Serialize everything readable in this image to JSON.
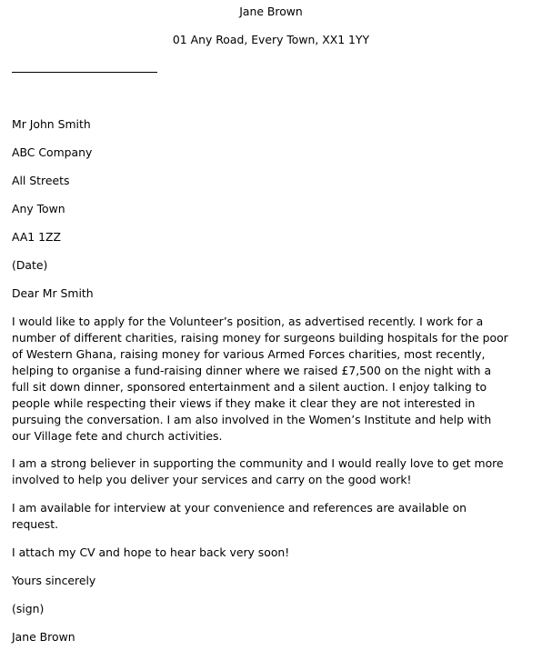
{
  "sender": {
    "name": "Jane Brown",
    "address": "01 Any Road, Every Town, XX1 1YY"
  },
  "recipient": {
    "name": "Mr John Smith",
    "company": "ABC Company",
    "street": "All Streets",
    "town": "Any Town",
    "postcode": "AA1 1ZZ"
  },
  "date": "(Date)",
  "salutation": "Dear Mr Smith",
  "body": {
    "paragraph1": [
      "I would like to apply for the Volunteer’s position, as advertised recently. I work for a",
      "number of different charities, raising money for surgeons building hospitals for the poor",
      "of Western Ghana, raising money for various Armed Forces charities, most recently,",
      "helping to organise a fund-raising dinner where we raised £7,500 on the night with a",
      "full sit down dinner, sponsored entertainment and a silent auction. I enjoy talking to",
      "people while respecting their views if they make it clear they are not interested in",
      "pursuing the conversation. I am also involved in the Women’s Institute and help with",
      "our Village fete and church activities."
    ],
    "paragraph2": [
      "I am a strong believer in supporting the community and I would really love to get more",
      "involved to help you deliver your services and carry on the good work!"
    ],
    "paragraph3": [
      "I am available for interview at your convenience and references are available on",
      "request."
    ],
    "paragraph4": [
      "I attach my CV and hope to hear back very soon!"
    ]
  },
  "closing": "Yours sincerely",
  "signature": "(sign)",
  "signoff_name": "Jane Brown"
}
